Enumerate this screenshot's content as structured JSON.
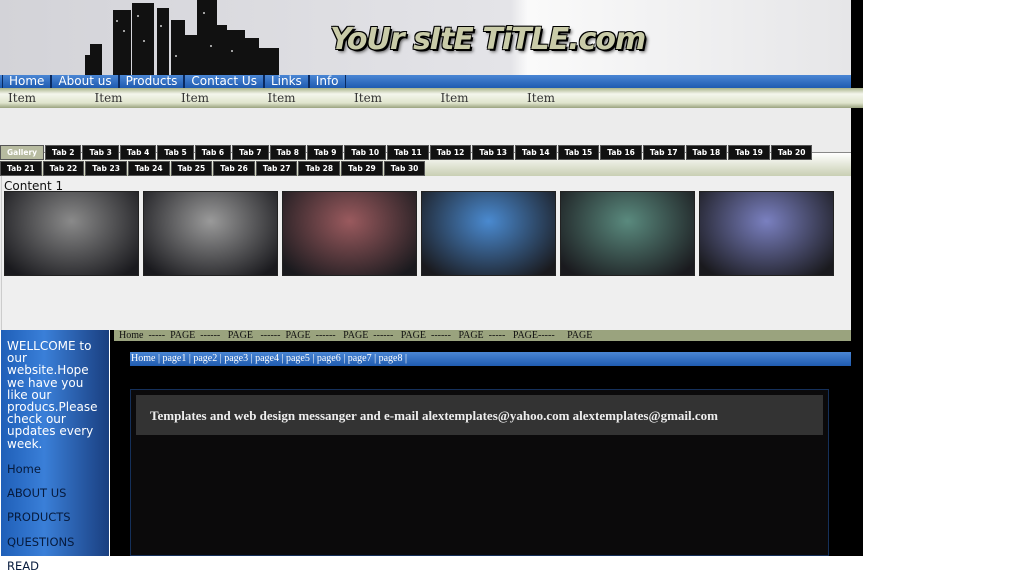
{
  "header": {
    "site_title": "YoUr sItE TiTLE.com"
  },
  "nav": [
    "Home",
    "About us",
    "Products",
    "Contact Us",
    "Links",
    "Info"
  ],
  "item_bar": [
    "Item",
    "Item",
    "Item",
    "Item",
    "Item",
    "Item",
    "Item"
  ],
  "tabs": [
    "Gallery",
    "Tab 2",
    "Tab 3",
    "Tab 4",
    "Tab 5",
    "Tab 6",
    "Tab 7",
    "Tab 8",
    "Tab 9",
    "Tab 10",
    "Tab 11",
    "Tab 12",
    "Tab 13",
    "Tab 14",
    "Tab 15",
    "Tab 16",
    "Tab 17",
    "Tab 18",
    "Tab 19",
    "Tab 20",
    "Tab 21",
    "Tab 22",
    "Tab 23",
    "Tab 24",
    "Tab 25",
    "Tab 26",
    "Tab 27",
    "Tab 28",
    "Tab 29",
    "Tab 30"
  ],
  "active_tab": "Gallery",
  "content": {
    "label": "Content 1",
    "thumb_colors": [
      "#8a8a8a",
      "#9a9a9a",
      "#9a5a5e",
      "#4a8ad0",
      "#5a8a7e",
      "#7a80c0"
    ]
  },
  "sidebar": {
    "welcome": "WELLCOME to our website.Hope we have you like our producs.Please check our updates every week.",
    "links": [
      "Home",
      "ABOUT US",
      "PRODUCTS",
      "QUESTIONS",
      "READ"
    ]
  },
  "page_bar": "Home  -----  PAGE  ------   PAGE   ------  PAGE  ------   PAGE  ------   PAGE  ------   PAGE  -----   PAGE-----     PAGE",
  "blue_bar": "Home | page1 | page2 | page3 | page4 | page5 | page6 | page7 | page8 |",
  "message": "Templates and web design messanger and e-mail alextemplates@yahoo.com alextemplates@gmail.com"
}
